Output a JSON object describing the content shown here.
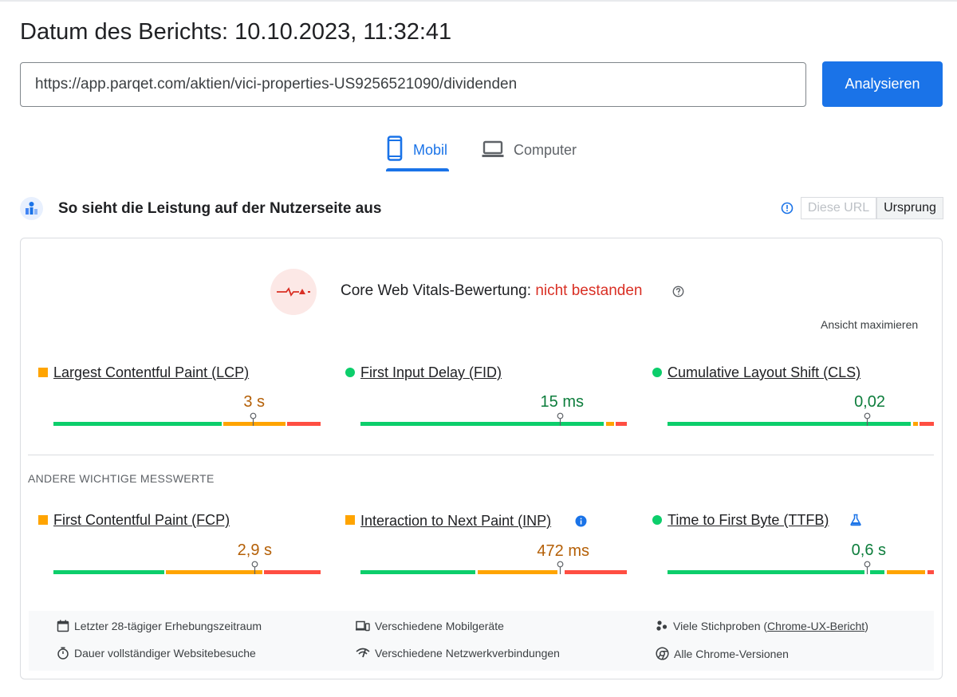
{
  "report_date": "Datum des Berichts: 10.10.2023, 11:32:41",
  "search": {
    "url_value": "https://app.parqet.com/aktien/vici-properties-US9256521090/dividenden",
    "analyze_label": "Analysieren"
  },
  "tabs": [
    {
      "label": "Mobil",
      "selected": true
    },
    {
      "label": "Computer",
      "selected": false
    }
  ],
  "section": {
    "title": "So sieht die Leistung auf der Nutzerseite aus",
    "toggle_this_url": "Diese URL",
    "toggle_origin": "Ursprung",
    "selected_toggle": "Ursprung"
  },
  "cwv": {
    "label": "Core Web Vitals-Bewertung: ",
    "status": "nicht bestanden",
    "expand": "Ansicht maximieren"
  },
  "core_metrics": [
    {
      "name": "Largest Contentful Paint (LCP)",
      "value": "3 s",
      "rating": "orange"
    },
    {
      "name": "First Input Delay (FID)",
      "value": "15 ms",
      "rating": "green"
    },
    {
      "name": "Cumulative Layout Shift (CLS)",
      "value": "0,02",
      "rating": "green"
    }
  ],
  "other_heading": "ANDERE WICHTIGE MESSWERTE",
  "other_metrics": [
    {
      "name": "First Contentful Paint (FCP)",
      "value": "2,9 s",
      "rating": "orange"
    },
    {
      "name": "Interaction to Next Paint (INP)",
      "value": "472 ms",
      "rating": "orange"
    },
    {
      "name": "Time to First Byte (TTFB)",
      "value": "0,6 s",
      "rating": "green"
    }
  ],
  "footer": {
    "period": "Letzter 28-tägiger Erhebungszeitraum",
    "duration": "Dauer vollständiger Websitebesuche",
    "devices": "Verschiedene Mobilgeräte",
    "network": "Verschiedene Netzwerkverbindungen",
    "samples": "Viele Stichproben (",
    "samples_link": "Chrome-UX-Bericht",
    "samples_end": ")",
    "versions": "Alle Chrome-Versionen"
  },
  "colors": {
    "accent": "#1a73e8",
    "fail": "#d93025",
    "good": "#0cce6b",
    "average": "#ffa400",
    "poor": "#ff4e42",
    "average_text": "#b45f06",
    "good_text": "#0d7d3c"
  }
}
